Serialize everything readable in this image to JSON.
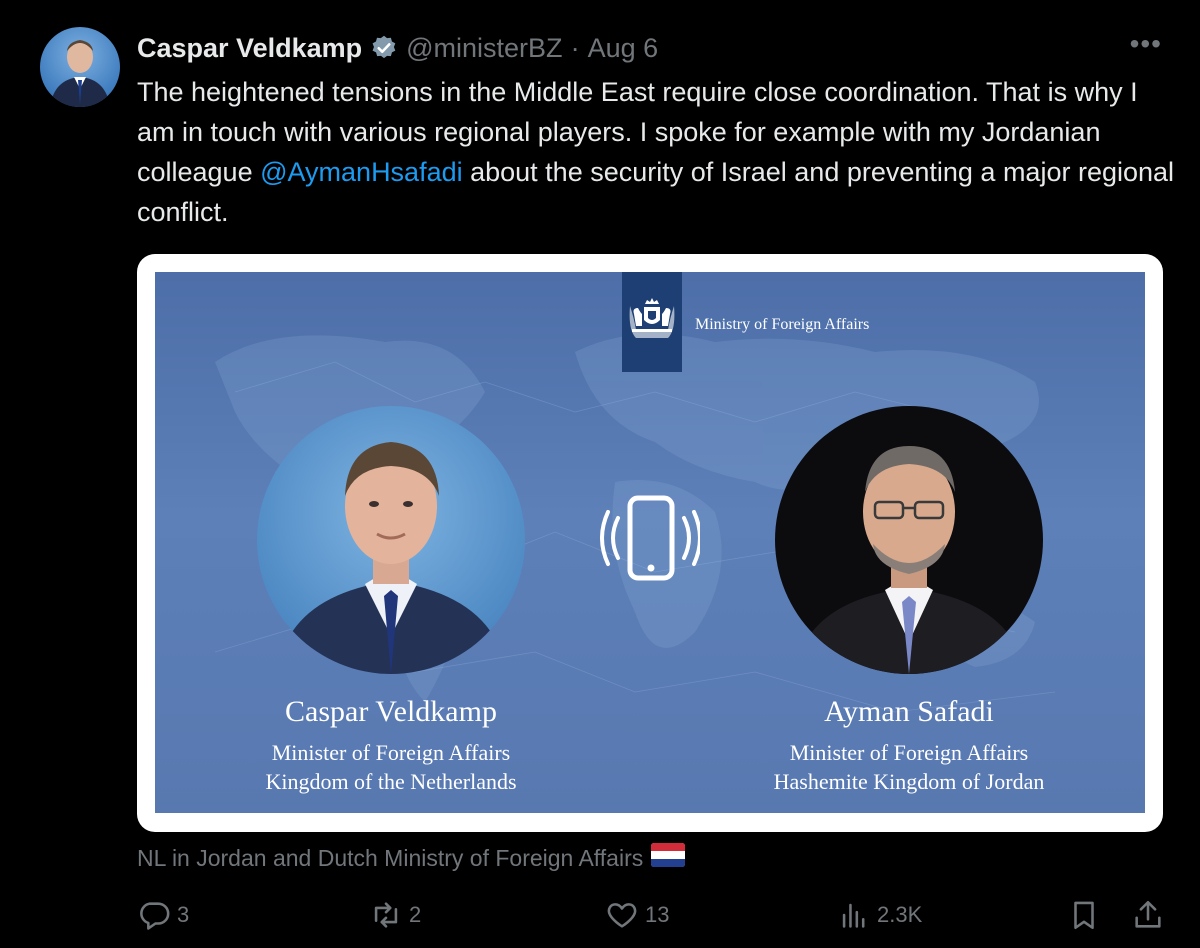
{
  "tweet": {
    "author_name": "Caspar Veldkamp",
    "handle": "@ministerBZ",
    "separator": "·",
    "date": "Aug 6",
    "more_label": "•••",
    "text_before_mention": "The heightened tensions in the Middle East require close coordination. That is why I am in touch with various regional players. I spoke for example with my Jordanian colleague ",
    "mention": "@AymanHsafadi",
    "text_after_mention": " about the security of Israel and preventing a major regional conflict.",
    "caption": "NL in Jordan and Dutch Ministry of Foreign Affairs"
  },
  "card": {
    "ministry": "Ministry of Foreign Affairs",
    "left_person": {
      "name": "Caspar Veldkamp",
      "role_line1": "Minister of Foreign Affairs",
      "role_line2": "Kingdom of the Netherlands"
    },
    "right_person": {
      "name": "Ayman Safadi",
      "role_line1": "Minister of Foreign Affairs",
      "role_line2": "Hashemite Kingdom of Jordan"
    }
  },
  "actions": {
    "replies": "3",
    "reposts": "2",
    "likes": "13",
    "views": "2.3K"
  },
  "icons": {
    "verified": "verified-badge-icon",
    "reply": "reply-icon",
    "repost": "repost-icon",
    "like": "heart-icon",
    "views": "views-chart-icon",
    "bookmark": "bookmark-icon",
    "share": "share-icon",
    "phone": "phone-call-icon",
    "flag": "netherlands-flag-icon"
  },
  "colors": {
    "background": "#000000",
    "text": "#e7e9ea",
    "muted": "#71767b",
    "link": "#1d9bf0",
    "card_blue": "#5878b0",
    "ribbon": "#1d3f73"
  }
}
